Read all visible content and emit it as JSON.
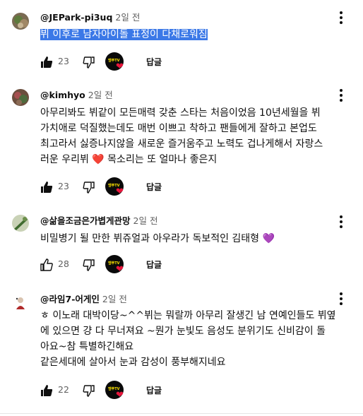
{
  "comments": [
    {
      "author": "@JEPark-pi3uq",
      "time": "2일 전",
      "text": "뷔 이후로 남자아이돌 표정이 다채로워짐",
      "likes": "23",
      "reply_label": "답글",
      "creator_badge": "엠뚜TV"
    },
    {
      "author": "@kimhyo",
      "time": "2일 전",
      "lines": [
        "아무리봐도 뷔같이 모든매력 갖춘 스타는 처음이었음 10년세월을 뷔",
        "가치애로 덕질했는데도 매번 이쁘고 착하고 팬들에게 잘하고 본업도",
        "최고라서 싫증나지않을 새로운 즐거움주고 노력도 겁나게해서 자랑스",
        "러운 우리뷔 ❤️  목소리는 또 얼마나 좋은지"
      ],
      "likes": "23",
      "reply_label": "답글",
      "creator_badge": "엠뚜TV"
    },
    {
      "author": "@삶을조금은가볍게관망",
      "time": "2일 전",
      "text": "비밀병기 될 만한 뷔쥬얼과 아우라가 독보적인 김태형 💜",
      "likes": "28",
      "reply_label": "답글",
      "creator_badge": "엠뚜TV"
    },
    {
      "author": "@라임7-어게인",
      "time": "2일 전",
      "lines": [
        "ㅎ 이노래 대박이당~^^뷔는 뭐랄까 아무리 잘생긴 남 연예인들도 뷔옆",
        "에 있으면 걍 다 무너져요 ~뭔가 눈빛도 음성도 분위기도 신비감이 돌",
        "아요~참 특별하긴해요",
        "같은세대에 살아서 눈과 감성이 풍부해지네요"
      ],
      "likes": "22",
      "reply_label": "답글",
      "creator_badge": "엠뚜TV"
    }
  ]
}
